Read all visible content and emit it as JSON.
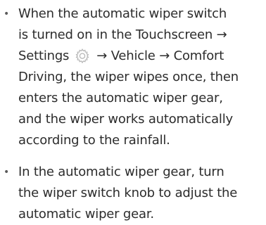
{
  "bullets": [
    {
      "lines": [
        "When the automatic wiper switch",
        "is turned on in the Touchscreen →"
      ],
      "settings_prefix": "Settings",
      "settings_suffix": "→ Vehicle → Comfort",
      "settings_icon": "gear-icon",
      "more_lines": [
        "Driving, the wiper wipes once, then",
        "enters the automatic wiper gear,",
        "and the wiper works automatically",
        "according to the rainfall."
      ]
    },
    {
      "lines": [
        "In the automatic wiper gear, turn",
        "the wiper switch knob to adjust the",
        "automatic wiper gear."
      ]
    }
  ],
  "bullet_glyph": "•",
  "colors": {
    "text": "#2c2c2c",
    "icon": "#b8b8b8"
  }
}
